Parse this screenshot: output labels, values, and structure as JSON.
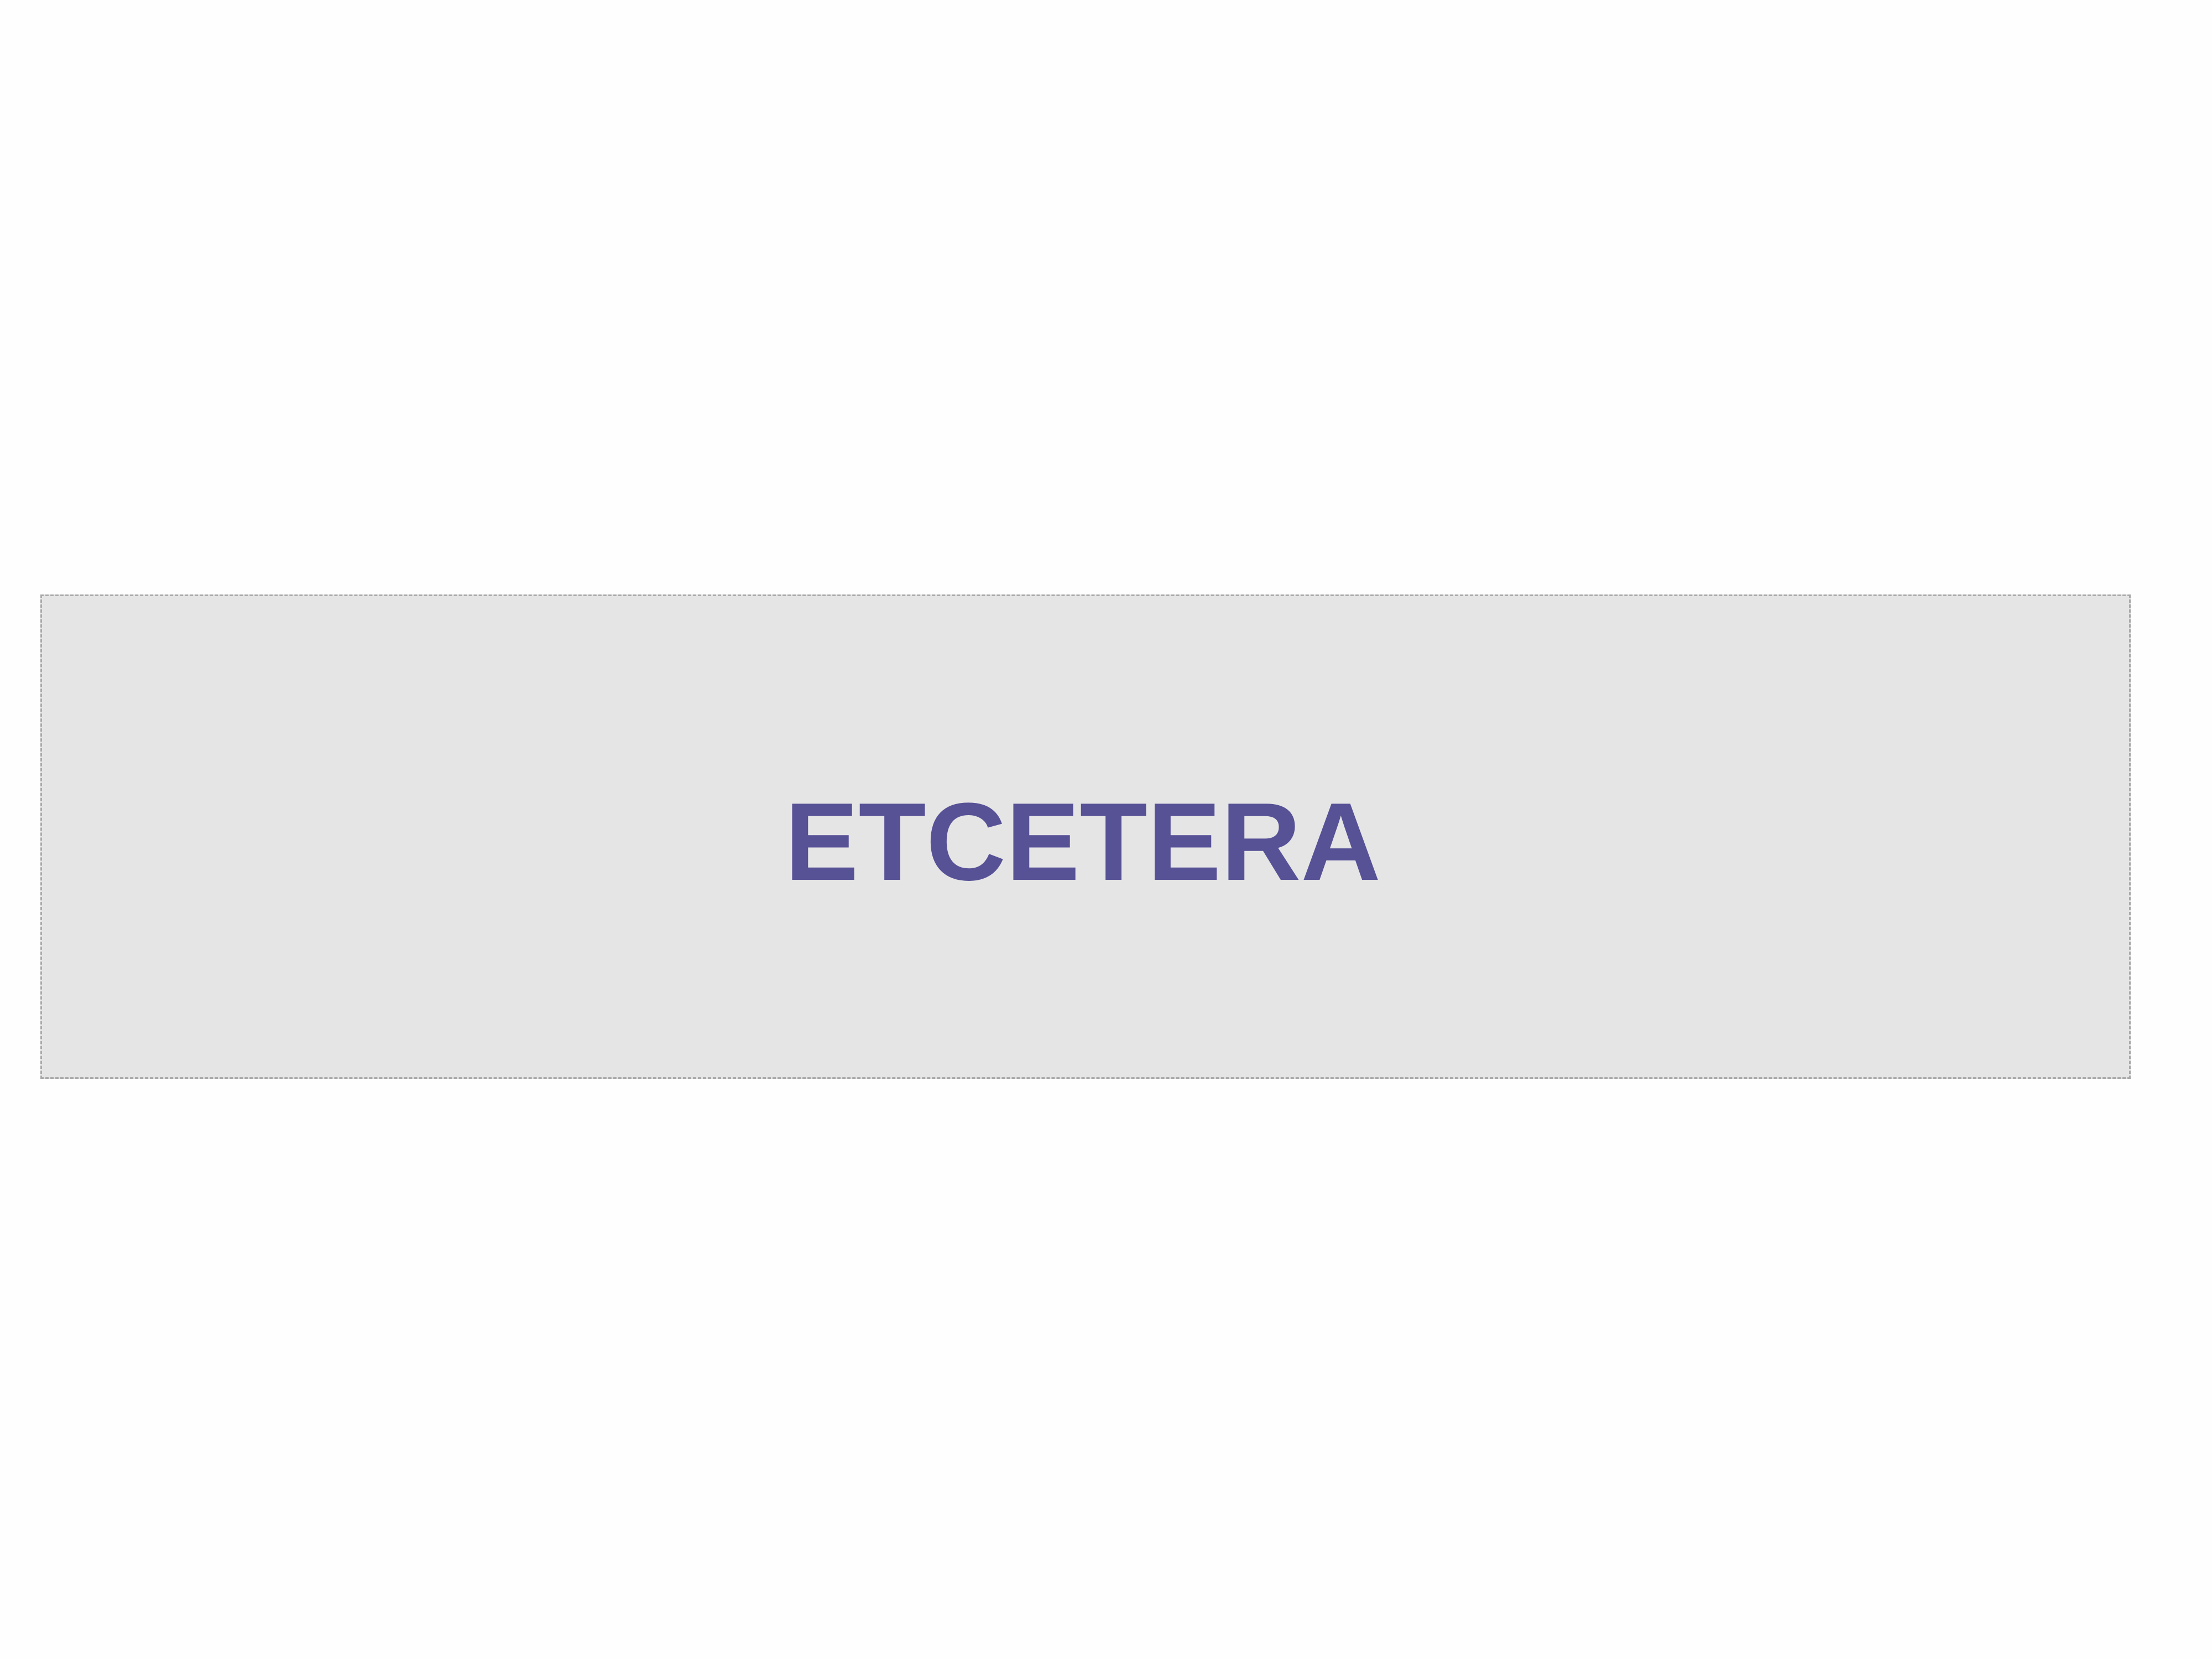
{
  "banner": {
    "text": "ETCETERA",
    "text_color": "#575196",
    "background_color": "#e5e5e6",
    "border_color": "#a9a9a9"
  },
  "page": {
    "background_color": "#fefefe"
  }
}
